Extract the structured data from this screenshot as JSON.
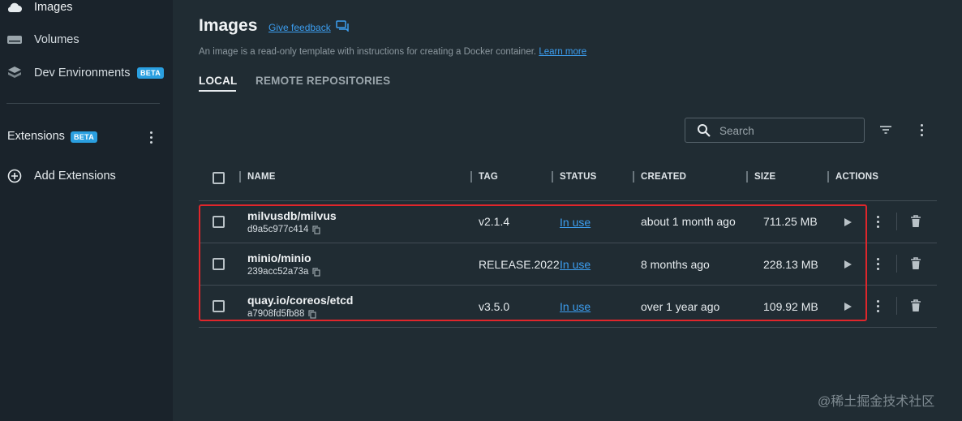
{
  "sidebar": {
    "items": [
      {
        "label": "Images",
        "icon": "cloud-icon"
      },
      {
        "label": "Volumes",
        "icon": "hard-drive-icon"
      },
      {
        "label": "Dev Environments",
        "icon": "cube-stack-icon",
        "badge": "BETA"
      }
    ],
    "extensions": {
      "label": "Extensions",
      "badge": "BETA"
    },
    "add_extensions": "Add Extensions"
  },
  "header": {
    "title": "Images",
    "feedback": "Give feedback",
    "description": "An image is a read-only template with instructions for creating a Docker container.",
    "learn_more": "Learn more"
  },
  "tabs": [
    {
      "label": "LOCAL",
      "active": true
    },
    {
      "label": "REMOTE REPOSITORIES",
      "active": false
    }
  ],
  "search": {
    "placeholder": "Search"
  },
  "table": {
    "columns": [
      "NAME",
      "TAG",
      "STATUS",
      "CREATED",
      "SIZE",
      "ACTIONS"
    ],
    "rows": [
      {
        "name": "milvusdb/milvus",
        "id": "d9a5c977c414",
        "tag": "v2.1.4",
        "status": "In use",
        "created": "about 1 month ago",
        "size": "711.25 MB"
      },
      {
        "name": "minio/minio",
        "id": "239acc52a73a",
        "tag": "RELEASE.2022",
        "status": "In use",
        "created": "8 months ago",
        "size": "228.13 MB"
      },
      {
        "name": "quay.io/coreos/etcd",
        "id": "a7908fd5fb88",
        "tag": "v3.5.0",
        "status": "In use",
        "created": "over 1 year ago",
        "size": "109.92 MB"
      }
    ]
  },
  "colors": {
    "accent": "#3c9ef0",
    "highlight": "#e0262b",
    "badge": "#2a9fe0"
  },
  "watermark": "@稀土掘金技术社区"
}
